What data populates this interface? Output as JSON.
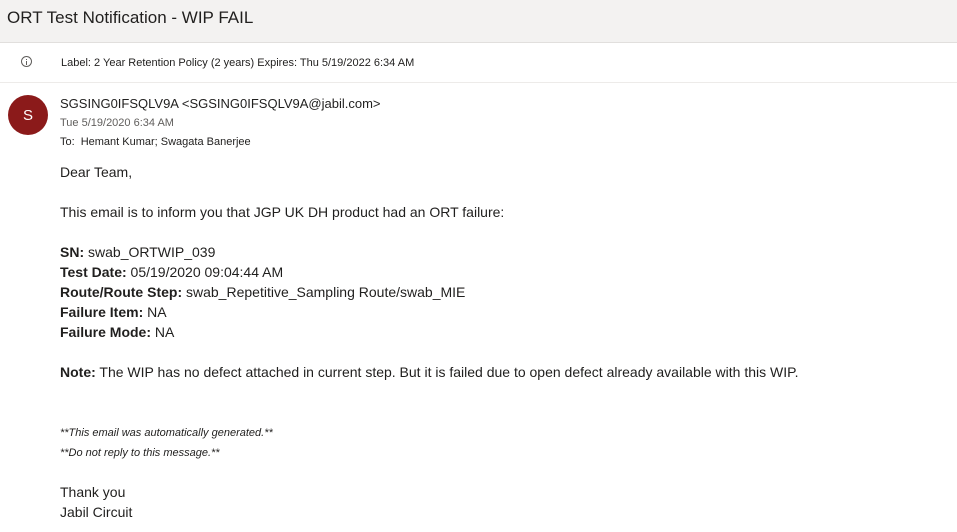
{
  "email": {
    "subject": "ORT Test Notification - WIP FAIL",
    "retention_label": "Label: 2 Year Retention Policy (2 years) Expires: Thu 5/19/2022 6:34 AM",
    "avatar_initial": "S",
    "avatar_color": "#8b1a1a",
    "sender": "SGSING0IFSQLV9A <SGSING0IFSQLV9A@jabil.com>",
    "sent_date": "Tue 5/19/2020 6:34 AM",
    "to_label": "To:",
    "to_recipients": "Hemant Kumar; Swagata Banerjee"
  },
  "body": {
    "greeting": "Dear Team,",
    "intro": "This email is to inform you that JGP UK DH product had an ORT failure:",
    "fields": [
      {
        "label": "SN:",
        "value": "swab_ORTWIP_039"
      },
      {
        "label": "Test Date:",
        "value": "05/19/2020 09:04:44 AM"
      },
      {
        "label": "Route/Route Step:",
        "value": "swab_Repetitive_Sampling Route/swab_MIE"
      },
      {
        "label": "Failure Item:",
        "value": "NA"
      },
      {
        "label": "Failure Mode:",
        "value": "NA"
      }
    ],
    "note_label": "Note:",
    "note_text": "The WIP has no defect attached in current step. But it is failed due to open defect already available with this WIP.",
    "auto_generated": "**This email was automatically generated.**",
    "do_not_reply": "**Do not reply to this message.**",
    "closing": "Thank you",
    "signature": "Jabil Circuit"
  }
}
